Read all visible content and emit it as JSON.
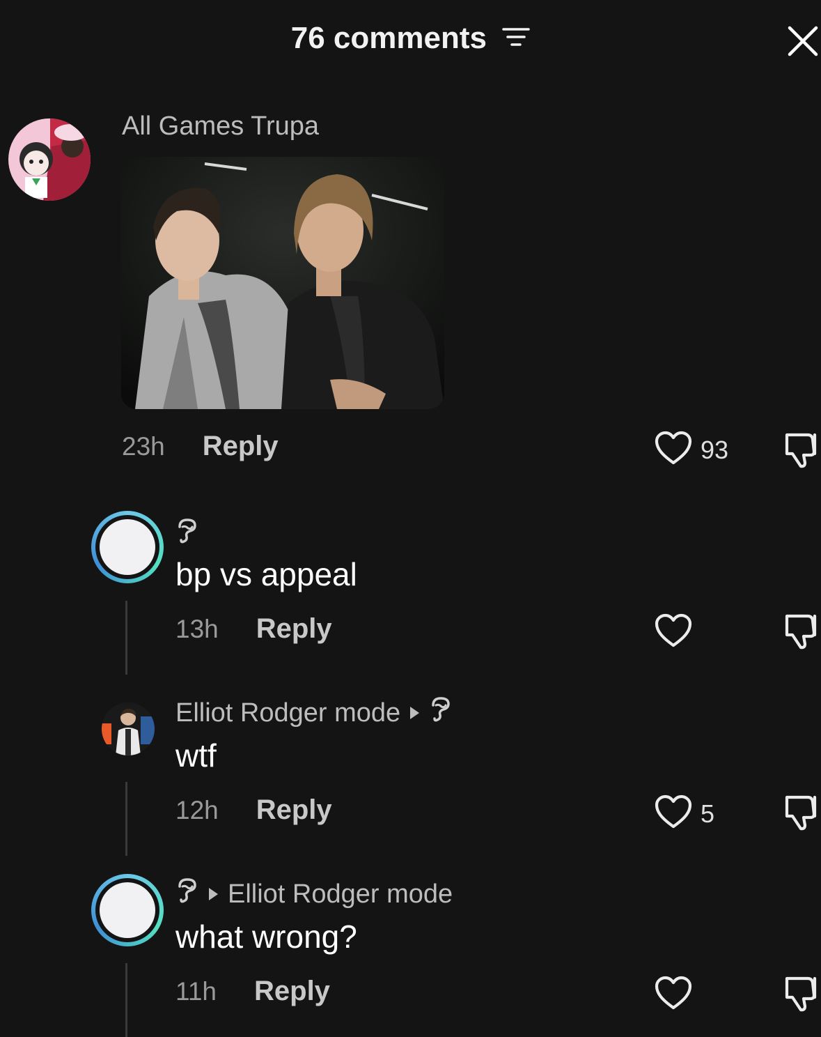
{
  "header": {
    "title": "76 comments"
  },
  "comments": [
    {
      "username": "All Games Trupa",
      "time": "23h",
      "reply_label": "Reply",
      "likes": "93"
    },
    {
      "text": "bp vs appeal",
      "time": "13h",
      "reply_label": "Reply",
      "likes": ""
    },
    {
      "username": "Elliot Rodger mode",
      "text": "wtf",
      "time": "12h",
      "reply_label": "Reply",
      "likes": "5"
    },
    {
      "reply_to": "Elliot Rodger mode",
      "text": "what wrong?",
      "time": "11h",
      "reply_label": "Reply",
      "likes": ""
    }
  ],
  "colors": {
    "background": "#141414",
    "ring_gradient": [
      "#6cc7e8",
      "#54e0c0",
      "#3f8fd6"
    ],
    "muted_text": "#9a9a9a"
  },
  "icons": [
    "sort-icon",
    "close-icon",
    "heart-icon",
    "dislike-icon",
    "caret-right-icon",
    "squiggle-emoji-icon"
  ]
}
